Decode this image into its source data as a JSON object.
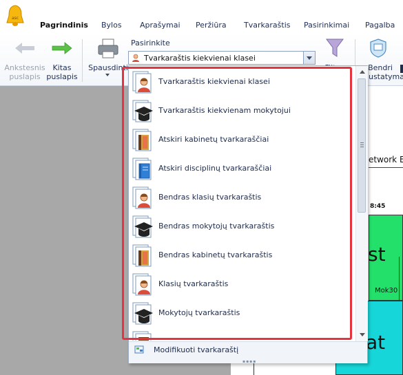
{
  "app": {
    "logo_text": "asc"
  },
  "menu": [
    {
      "label": "Pagrindinis",
      "active": true
    },
    {
      "label": "Bylos"
    },
    {
      "label": "Aprašymai"
    },
    {
      "label": "Peržiūra"
    },
    {
      "label": "Tvarkaraštis"
    },
    {
      "label": "Pasirinkimai"
    },
    {
      "label": "Pagalba"
    }
  ],
  "ribbon": {
    "prev_page": {
      "line1": "Ankstesnis",
      "line2": "puslapis",
      "enabled": false
    },
    "next_page": {
      "line1": "Kitas",
      "line2": "puslapis",
      "enabled": true
    },
    "print": {
      "label": "Spausdinti"
    },
    "select_label": "Pasirinkite",
    "combo_value": "Tvarkaraštis kiekvienai klasei",
    "filter": {
      "label": "Filtras"
    },
    "settings": {
      "line1": "Bendri",
      "line2": "nustatymai"
    }
  },
  "background": {
    "network_text": "etwork E",
    "time_text": "8:45",
    "big_text_1": "st",
    "big_text_2": "at",
    "mok_text": "Mok30"
  },
  "dropdown": {
    "items": [
      {
        "label": "Tvarkaraštis kiekvienai klasei",
        "icon": "class-person-icon"
      },
      {
        "label": "Tvarkaraštis kiekvienam mokytojui",
        "icon": "teacher-cap-icon"
      },
      {
        "label": "Atskiri kabinetų tvarkaraščiai",
        "icon": "classroom-door-icon"
      },
      {
        "label": "Atskiri disciplinų tvarkaraščiai",
        "icon": "subject-book-icon"
      },
      {
        "label": "Bendras klasių tvarkaraštis",
        "icon": "class-person-icon"
      },
      {
        "label": "Bendras mokytojų tvarkaraštis",
        "icon": "teacher-cap-icon"
      },
      {
        "label": "Bendras kabinetų tvarkaraštis",
        "icon": "classroom-door-icon"
      },
      {
        "label": "Klasių tvarkaraštis",
        "icon": "class-person-icon"
      },
      {
        "label": "Mokytojų tvarkaraštis",
        "icon": "teacher-cap-icon"
      }
    ],
    "footer_label": "Modifikuoti tvarkaraštį"
  },
  "colors": {
    "accent": "#e5343f",
    "green": "#22e06a",
    "cyan": "#16d6d9",
    "menu_text": "#1e2d52"
  }
}
